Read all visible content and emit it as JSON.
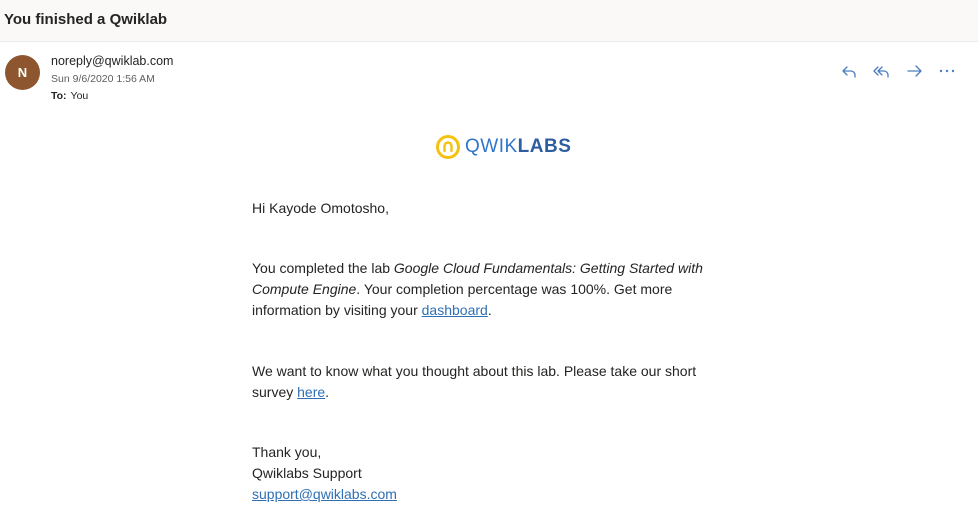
{
  "subject": "You finished a Qwiklab",
  "sender": {
    "initial": "N",
    "email": "noreply@qwiklab.com",
    "date": "Sun 9/6/2020 1:56 AM",
    "to_label": "To:",
    "to_value": "You",
    "avatar_color": "#8e562e"
  },
  "actions": {
    "reply": "reply-icon",
    "reply_all": "reply-all-icon",
    "forward": "forward-icon",
    "more": "more-icon"
  },
  "logo": {
    "text_light": "QWIK",
    "text_bold": "LABS"
  },
  "email_body": {
    "greeting": "Hi Kayode Omotosho,",
    "completion_prefix": "You completed the lab ",
    "lab_name": "Google Cloud Fundamentals: Getting Started with Compute Engine",
    "completion_middle": ". Your completion percentage was 100%. Get more information by visiting your ",
    "dashboard_link": "dashboard",
    "completion_suffix": ".",
    "survey_prefix": "We want to know what you thought about this lab. Please take our short survey ",
    "survey_link": "here",
    "survey_suffix": ".",
    "signoff": "Thank you,",
    "signature": "Qwiklabs Support",
    "support_email": "support@qwiklabs.com"
  },
  "colors": {
    "link": "#2f6fb4",
    "action_icon": "#4a7fbf",
    "logo_yellow": "#f4c20d"
  }
}
